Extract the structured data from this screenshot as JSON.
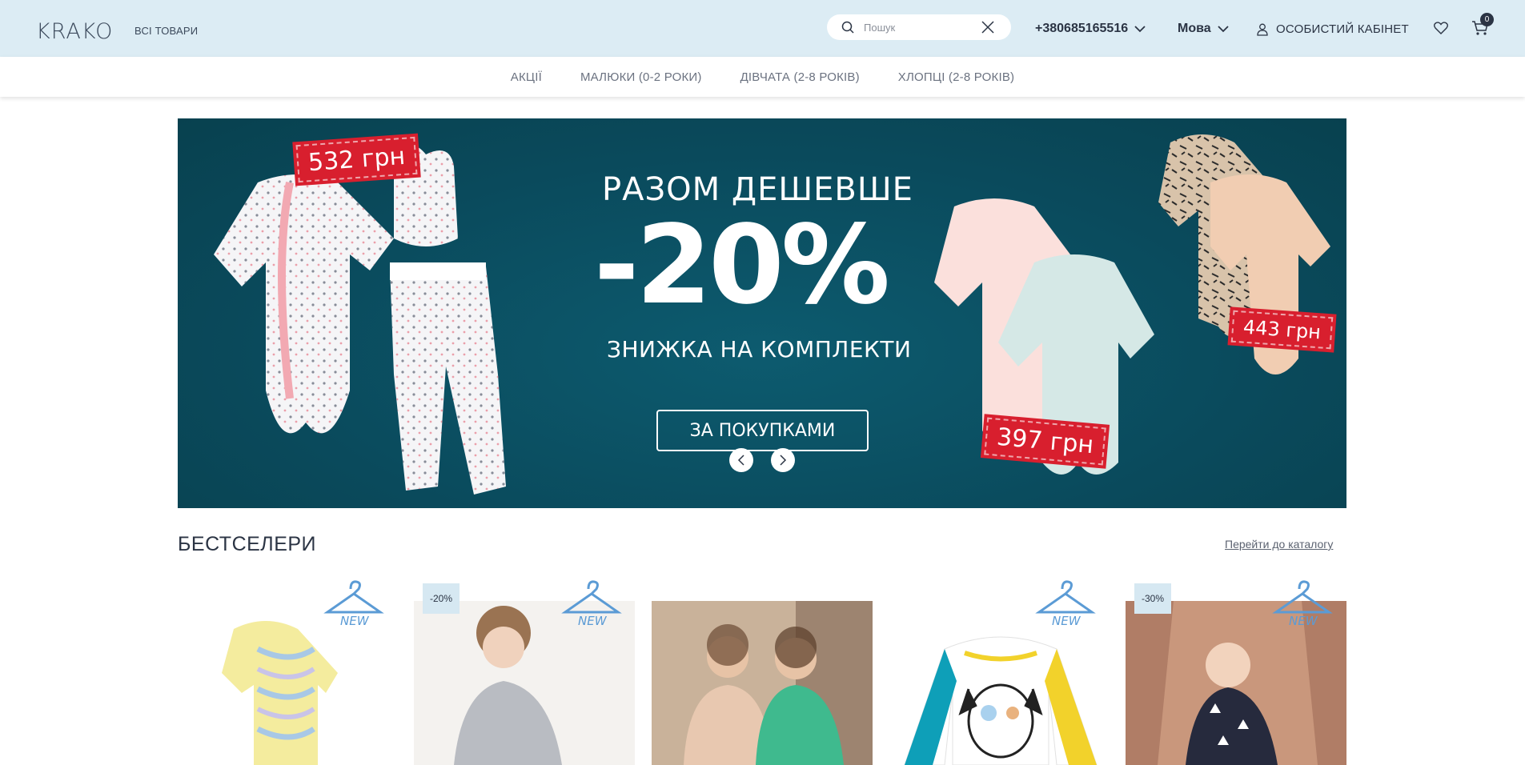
{
  "header": {
    "logo": "KRAKO",
    "all_goods": "ВСІ ТОВАРИ",
    "search_placeholder": "Пошук",
    "phone": "+380685165516",
    "language": "Мова",
    "account": "ОСОБИСТИЙ КАБІНЕТ",
    "cart_count": "0"
  },
  "nav": {
    "items": [
      {
        "label": "АКЦІЇ"
      },
      {
        "label": "МАЛЮКИ (0-2 РОКИ)"
      },
      {
        "label": "ДІВЧАТА (2-8 РОКІВ)"
      },
      {
        "label": "ХЛОПЦІ (2-8 РОКІВ)"
      }
    ]
  },
  "hero": {
    "title": "РАЗОМ ДЕШЕВШЕ",
    "discount": "-20%",
    "subtitle": "ЗНИЖКА НА КОМПЛЕКТИ",
    "button": "ЗА ПОКУПКАМИ",
    "prices": [
      "532 грн",
      "443 грн",
      "397 грн"
    ]
  },
  "bestsellers": {
    "title": "БЕСТСЕЛЕРИ",
    "catalog_link": "Перейти до каталогу",
    "new_label": "NEW",
    "products": [
      {
        "badge": "",
        "is_new": true
      },
      {
        "badge": "-20%",
        "is_new": true
      },
      {
        "badge": "",
        "is_new": false
      },
      {
        "badge": "",
        "is_new": true
      },
      {
        "badge": "-30%",
        "is_new": true
      }
    ]
  },
  "colors": {
    "header_bg": "#dcecf4",
    "hero_bg": "#0a4a5c",
    "price_tag": "#d81f2e",
    "badge_bg": "#d6e8f2",
    "new_hanger": "#5b9bd5"
  }
}
